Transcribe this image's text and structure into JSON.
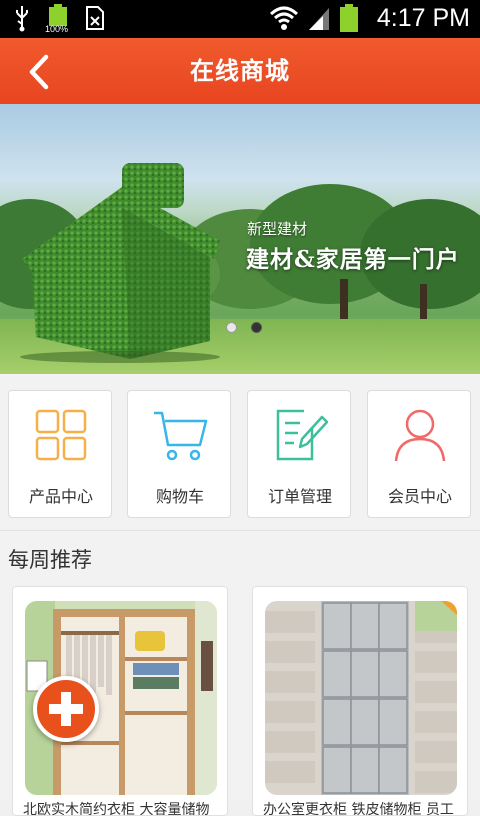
{
  "status_bar": {
    "time": "4:17 PM",
    "battery_small_label": "100%",
    "icons": [
      "usb-icon",
      "battery-full-icon",
      "sim-icon",
      "wifi-icon",
      "signal-icon",
      "battery-icon"
    ]
  },
  "header": {
    "title": "在线商城",
    "back_icon": "back-chevron-icon"
  },
  "banner": {
    "subtitle": "新型建材",
    "headline": "建材&家居第一门户",
    "slides": 2,
    "active_slide": 2
  },
  "nav": {
    "items": [
      {
        "label": "产品中心",
        "icon": "grid-icon",
        "color": "#f5b04a"
      },
      {
        "label": "购物车",
        "icon": "cart-icon",
        "color": "#38b6e8"
      },
      {
        "label": "订单管理",
        "icon": "order-edit-icon",
        "color": "#3dbf9c"
      },
      {
        "label": "会员中心",
        "icon": "user-icon",
        "color": "#f06a6a"
      }
    ]
  },
  "recommend": {
    "title": "每周推荐",
    "products": [
      {
        "name": "北欧实木简约衣柜 大容量储物"
      },
      {
        "name": "办公室更衣柜 铁皮储物柜 员工"
      }
    ],
    "fab_icon": "plus-icon"
  },
  "colors": {
    "accent": "#e84520",
    "header_top": "#f05a2c"
  }
}
